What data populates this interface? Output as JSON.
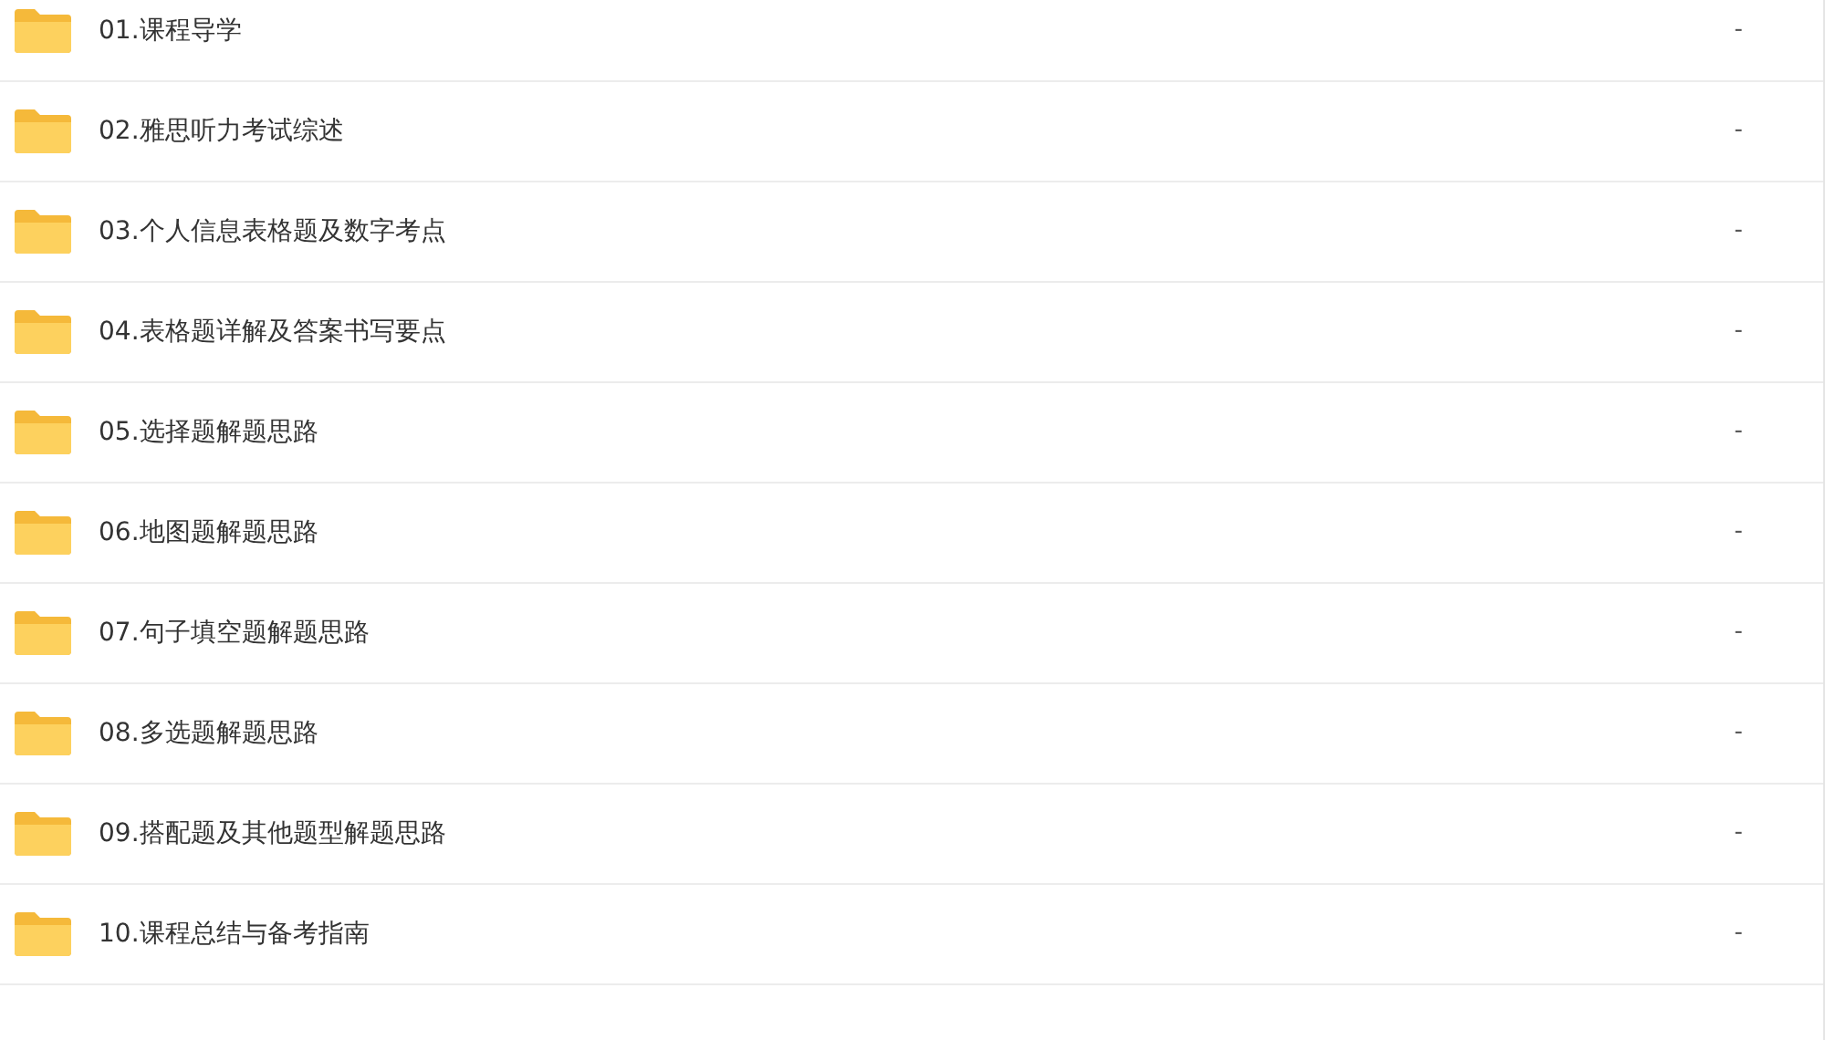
{
  "files": [
    {
      "name": "01.课程导学",
      "size": "-"
    },
    {
      "name": "02.雅思听力考试综述",
      "size": "-"
    },
    {
      "name": "03.个人信息表格题及数字考点",
      "size": "-"
    },
    {
      "name": "04.表格题详解及答案书写要点",
      "size": "-"
    },
    {
      "name": "05.选择题解题思路",
      "size": "-"
    },
    {
      "name": "06.地图题解题思路",
      "size": "-"
    },
    {
      "name": "07.句子填空题解题思路",
      "size": "-"
    },
    {
      "name": "08.多选题解题思路",
      "size": "-"
    },
    {
      "name": "09.搭配题及其他题型解题思路",
      "size": "-"
    },
    {
      "name": "10.课程总结与备考指南",
      "size": "-"
    }
  ]
}
